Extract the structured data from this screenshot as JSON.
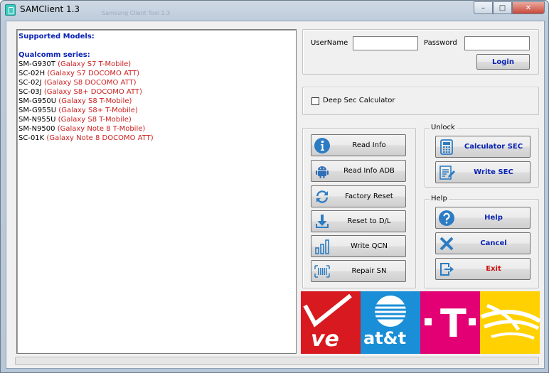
{
  "window": {
    "title": "SAMClient 1.3",
    "ghost_title": "Samsung Client Tool 1.3",
    "controls": {
      "minimize": "–",
      "maximize": "□",
      "close": "✕"
    }
  },
  "models": {
    "heading": "Supported Models:",
    "series_heading": "Qualcomm series:",
    "items": [
      {
        "code": "SM-G930T",
        "desc": "(Galaxy S7 T-Mobile)"
      },
      {
        "code": "SC-02H",
        "desc": "(Galaxy S7 DOCOMO ATT)"
      },
      {
        "code": "SC-02J",
        "desc": "(Galaxy S8 DOCOMO ATT)"
      },
      {
        "code": "SC-03J",
        "desc": "(Galaxy S8+ DOCOMO ATT)"
      },
      {
        "code": "SM-G950U",
        "desc": "(Galaxy S8 T-Mobile)"
      },
      {
        "code": "SM-G955U",
        "desc": "(Galaxy S8+ T-Mobile)"
      },
      {
        "code": "SM-N955U",
        "desc": "(Galaxy S8 T-Mobile)"
      },
      {
        "code": "SM-N9500",
        "desc": "(Galaxy Note 8 T-Mobile)"
      },
      {
        "code": "SC-01K",
        "desc": "(Galaxy Note 8 DOCOMO ATT)"
      }
    ]
  },
  "login": {
    "username_label": "UserName",
    "username_value": "",
    "password_label": "Password",
    "password_value": "",
    "login_button": "Login"
  },
  "deep_sec": {
    "label": "Deep Sec Calculator",
    "checked": false
  },
  "actions": [
    {
      "label": "Read Info",
      "icon": "info-icon"
    },
    {
      "label": "Read Info ADB",
      "icon": "android-icon"
    },
    {
      "label": "Factory Reset",
      "icon": "refresh-icon"
    },
    {
      "label": "Reset to D/L",
      "icon": "download-icon"
    },
    {
      "label": "Write QCN",
      "icon": "bars-icon"
    },
    {
      "label": "Repair SN",
      "icon": "barcode-icon"
    }
  ],
  "unlock": {
    "legend": "Unlock",
    "calculator_sec": "Calculator SEC",
    "write_sec": "Write SEC"
  },
  "help": {
    "legend": "Help",
    "help_button": "Help",
    "cancel_button": "Cancel",
    "exit_button": "Exit"
  },
  "carriers": {
    "verizon": "ve",
    "att": "at&t",
    "tmobile": "T",
    "sprint": "sprint-logo"
  },
  "colors": {
    "blue_text": "#0a23b4",
    "red_text": "#cc2020",
    "icon_blue": "#2c7cc4",
    "android_blue": "#2f6fb7"
  }
}
